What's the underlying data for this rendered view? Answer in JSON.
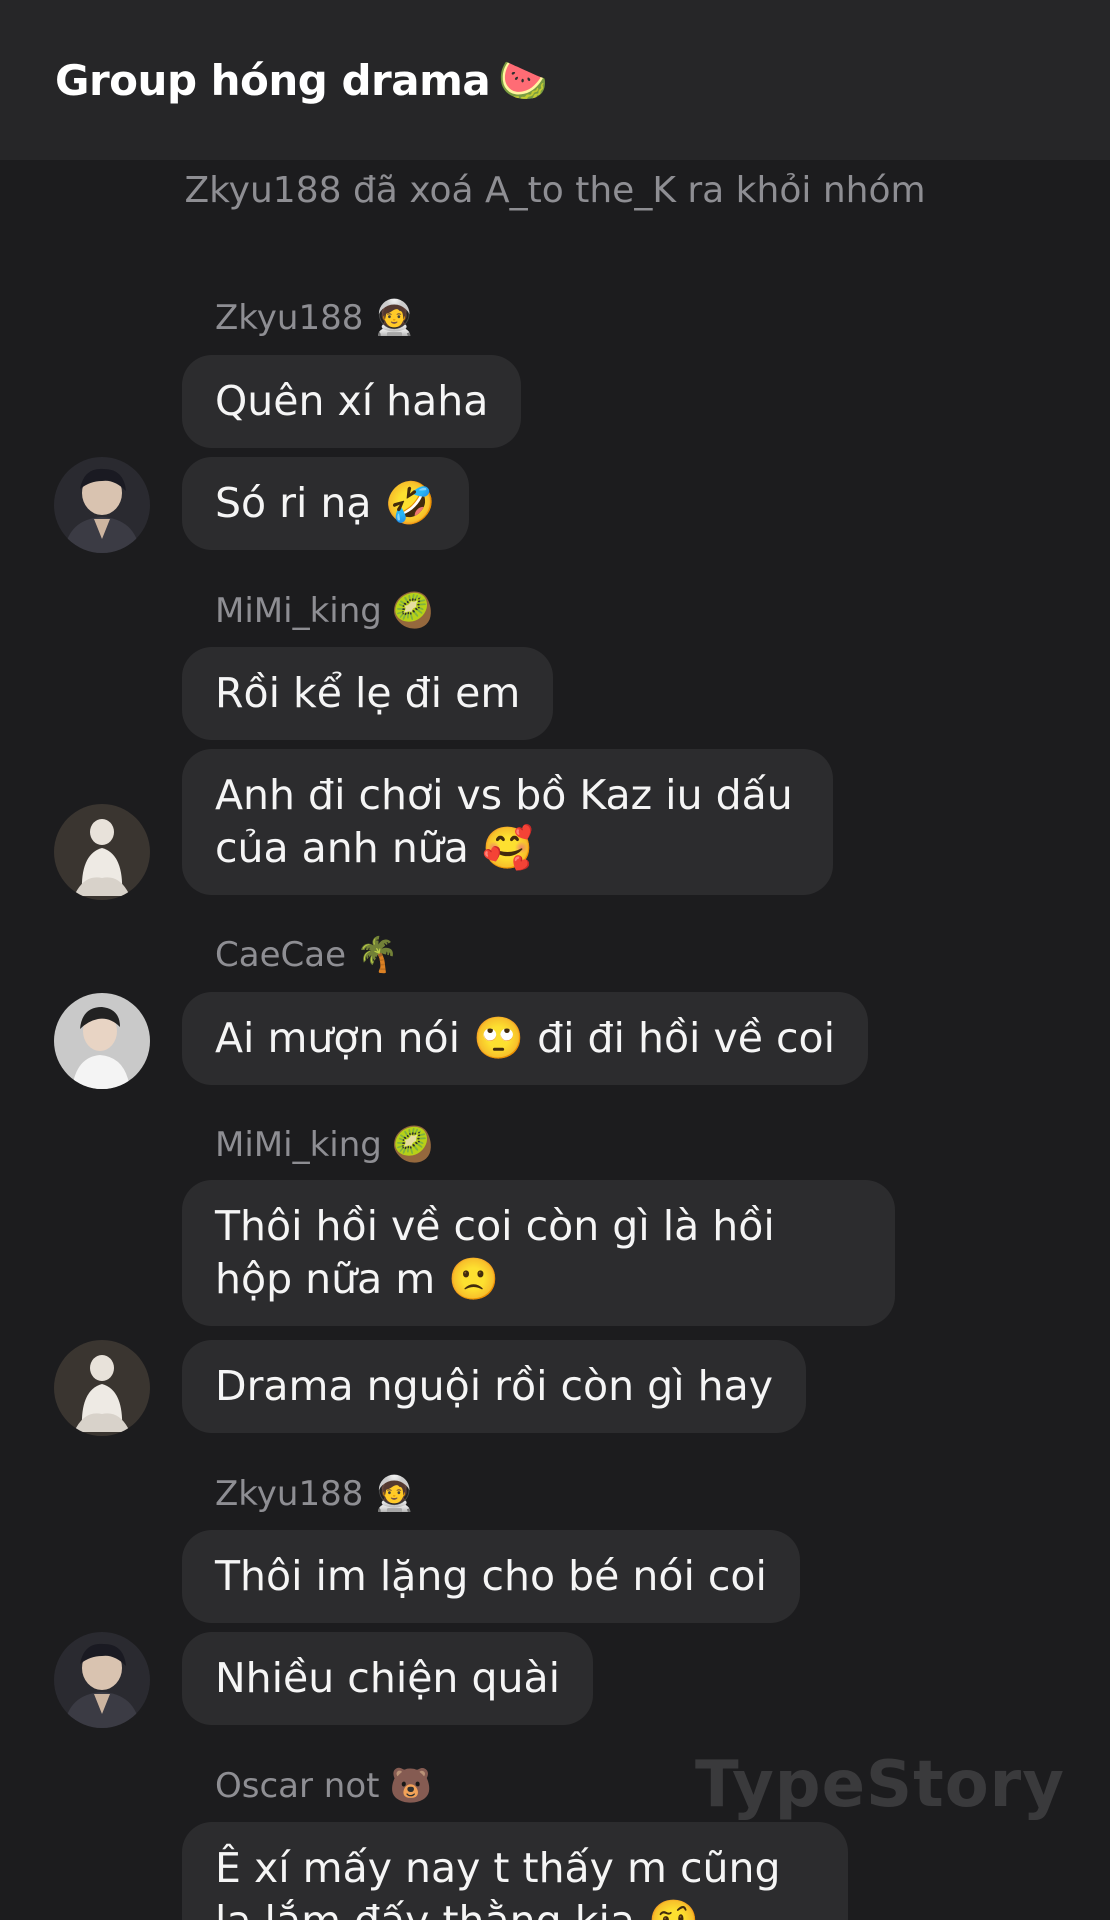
{
  "header": {
    "title": "Group hóng drama",
    "title_emoji": "🍉"
  },
  "system_message": "Zkyu188 đã xoá A_to the_K ra khỏi nhóm",
  "groups": [
    {
      "sender": "Zkyu188",
      "sender_emoji": "🧑‍🚀",
      "avatar": "avatar-zkyu188",
      "messages": [
        "Quên xí haha",
        "Só ri nạ 🤣"
      ]
    },
    {
      "sender": "MiMi_king",
      "sender_emoji": "🥝",
      "avatar": "avatar-mimi-king",
      "messages": [
        "Rồi kể lẹ đi em",
        "Anh đi chơi vs bồ Kaz iu dấu của anh nữa 🥰"
      ]
    },
    {
      "sender": "CaeCae",
      "sender_emoji": "🌴",
      "avatar": "avatar-caecae",
      "messages": [
        "Ai mượn nói 🙄 đi đi hồi về coi"
      ]
    },
    {
      "sender": "MiMi_king",
      "sender_emoji": "🥝",
      "avatar": "avatar-mimi-king",
      "messages": [
        "Thôi hồi về coi còn gì là hồi hộp nữa m 🙁",
        "Drama nguội rồi còn gì hay"
      ]
    },
    {
      "sender": "Zkyu188",
      "sender_emoji": "🧑‍🚀",
      "avatar": "avatar-zkyu188",
      "messages": [
        "Thôi im lặng cho bé nói coi",
        "Nhiều chiện quài"
      ]
    },
    {
      "sender": "Oscar not",
      "sender_emoji": "🐻",
      "avatar": "",
      "messages": [
        "Ê xí mấy nay t thấy m cũng lạ lắm đấy thằng kia 🤨"
      ]
    }
  ],
  "watermark": "TypeStory",
  "colors": {
    "background": "#1c1c1e",
    "header": "#262628",
    "bubble": "#2c2c2e",
    "sender_text": "#8e8e93",
    "message_text": "#f5f5f5"
  }
}
